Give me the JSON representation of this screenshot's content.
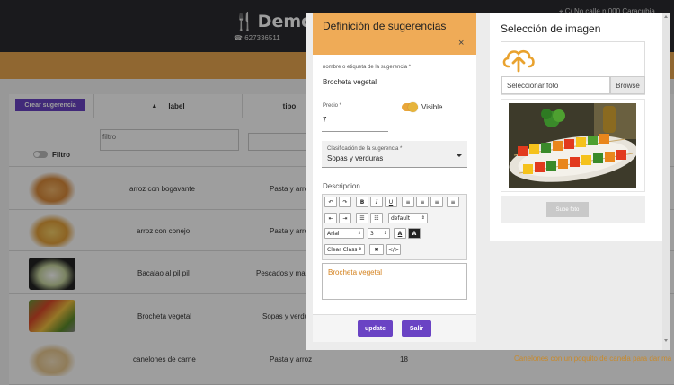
{
  "header": {
    "brand": "Demostr",
    "phone": "627336511",
    "address": "C/ No calle n 000 Caracubia"
  },
  "table": {
    "create_button": "Crear sugerencia",
    "col_label": "label",
    "col_tipo": "tipo",
    "filter_placeholder": "filtro",
    "filter_toggle_label": "Filtro",
    "rows": [
      {
        "label": "arroz con bogavante",
        "tipo": "Pasta y arroz"
      },
      {
        "label": "arroz con conejo",
        "tipo": "Pasta y arroz"
      },
      {
        "label": "Bacalao al pil pil",
        "tipo": "Pescados y mariscos"
      },
      {
        "label": "Brocheta vegetal",
        "tipo": "Sopas y verduras"
      },
      {
        "label": "canelones de carne",
        "tipo": "Pasta y arroz",
        "precio": "18",
        "descripcion": "Canelones con un poquito de canela para dar ma"
      }
    ]
  },
  "definicion": {
    "title": "Definición de sugerencias",
    "close": "×",
    "name_label": "nombre o etiqueta de la sugerencia *",
    "name_value": "Brocheta vegetal",
    "price_label": "Precio *",
    "price_value": "7",
    "visible_label": "Visible",
    "visible_on": true,
    "class_label": "Clasificación de la sugerencia *",
    "class_value": "Sopas y verduras",
    "desc_label": "Descripcion",
    "desc_value": "Brocheta vegetal",
    "update_button": "update",
    "exit_button": "Salir"
  },
  "editor": {
    "undo": "↶",
    "redo": "↷",
    "bold": "B",
    "italic": "I",
    "underline": "U",
    "style_select": "default",
    "font_select": "Arial",
    "size_select": "3",
    "clear_select": "Clear Class",
    "remove": "✖",
    "code": "</>"
  },
  "imagen": {
    "title": "Selección de imagen",
    "file_placeholder": "Seleccionar foto",
    "browse": "Browse",
    "upload_button": "Sube foto"
  },
  "colors": {
    "accent_orange": "#efab57",
    "purple": "#6a43c4",
    "dark_header": "#2a2b2f"
  }
}
